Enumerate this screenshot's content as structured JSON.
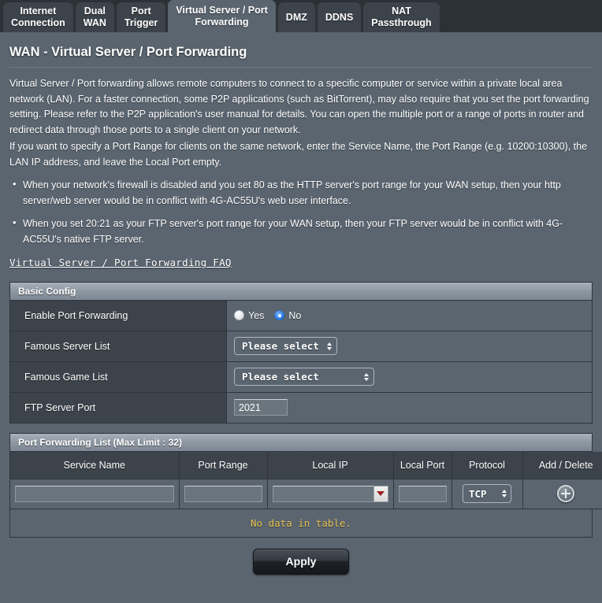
{
  "tabs": [
    {
      "label_line1": "Internet",
      "label_line2": "Connection",
      "active": false
    },
    {
      "label_line1": "Dual",
      "label_line2": "WAN",
      "active": false
    },
    {
      "label_line1": "Port",
      "label_line2": "Trigger",
      "active": false
    },
    {
      "label_line1": "Virtual Server / Port",
      "label_line2": "Forwarding",
      "active": true
    },
    {
      "label_line1": "DMZ",
      "label_line2": "",
      "active": false
    },
    {
      "label_line1": "DDNS",
      "label_line2": "",
      "active": false
    },
    {
      "label_line1": "NAT",
      "label_line2": "Passthrough",
      "active": false
    }
  ],
  "page": {
    "title": "WAN - Virtual Server / Port Forwarding",
    "paragraph1": "Virtual Server / Port forwarding allows remote computers to connect to a specific computer or service within a private local area network (LAN). For a faster connection, some P2P applications (such as BitTorrent), may also require that you set the port forwarding setting. Please refer to the P2P application's user manual for details. You can open the multiple port or a range of ports in router and redirect data through those ports to a single client on your network.",
    "paragraph2": "If you want to specify a Port Range for clients on the same network, enter the Service Name, the Port Range (e.g. 10200:10300), the LAN IP address, and leave the Local Port empty.",
    "notes": [
      "When your network's firewall is disabled and you set 80 as the HTTP server's port range for your WAN setup, then your http server/web server would be in conflict with 4G-AC55U's web user interface.",
      "When you set 20:21 as your FTP server's port range for your WAN setup, then your FTP server would be in conflict with 4G-AC55U's native FTP server."
    ],
    "faq_link": "Virtual Server / Port Forwarding FAQ"
  },
  "basic_config": {
    "header": "Basic Config",
    "enable_port_forwarding": {
      "label": "Enable Port Forwarding",
      "options": [
        "Yes",
        "No"
      ],
      "selected": "No"
    },
    "famous_server_list": {
      "label": "Famous Server List",
      "value": "Please select"
    },
    "famous_game_list": {
      "label": "Famous Game List",
      "value": "Please select"
    },
    "ftp_server_port": {
      "label": "FTP Server Port",
      "value": "2021",
      "placeholder": ""
    }
  },
  "forwarding_list": {
    "header": "Port Forwarding List (Max Limit : 32)",
    "columns": [
      "Service Name",
      "Port Range",
      "Local IP",
      "Local Port",
      "Protocol",
      "Add / Delete"
    ],
    "input_row": {
      "service_name": "",
      "service_name_placeholder": "",
      "port_range": "",
      "port_range_placeholder": "",
      "local_ip": "",
      "local_ip_placeholder": "",
      "local_port": "",
      "local_port_placeholder": "",
      "protocol": "TCP",
      "add_icon": "plus-circle-icon",
      "ip_dropdown_icon": "triangle-down-icon"
    },
    "empty_message": "No data in table."
  },
  "footer": {
    "apply_label": "Apply"
  },
  "colors": {
    "page_bg": "#5a6570",
    "tabbar_bg": "#2c3136",
    "tab_bg": "#3d434b",
    "panel_header_light": "#a9b1bb",
    "accent_radio": "#2b7ff0",
    "empty_text": "#e8c252",
    "dropdown_arrow_red": "#9e1d1d"
  }
}
